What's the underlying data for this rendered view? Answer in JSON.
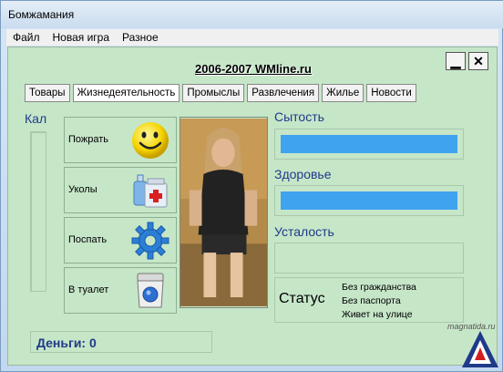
{
  "window": {
    "title": "Бомжамания"
  },
  "menu": {
    "items": [
      "Файл",
      "Новая игра",
      "Разное"
    ]
  },
  "banner": "2006-2007 WMline.ru",
  "window_buttons": {
    "minimize": "▁",
    "close": "✕"
  },
  "tabs": [
    "Товары",
    "Жизнедеятельность",
    "Промыслы",
    "Развлечения",
    "Жилье",
    "Новости"
  ],
  "active_tab": 1,
  "kal": {
    "label": "Кал",
    "level": 0
  },
  "actions": [
    {
      "label": "Пожрать",
      "icon": "smiley-icon"
    },
    {
      "label": "Уколы",
      "icon": "medicine-icon"
    },
    {
      "label": "Поспать",
      "icon": "gear-icon"
    },
    {
      "label": "В туалет",
      "icon": "toilet-icon"
    }
  ],
  "stats": {
    "satiety": {
      "label": "Сытость",
      "value": 1.0
    },
    "health": {
      "label": "Здоровье",
      "value": 1.0
    },
    "fatigue": {
      "label": "Усталость",
      "value": 0.0
    }
  },
  "status": {
    "label": "Статус",
    "lines": [
      "Без гражданства",
      "Без паспорта",
      "Живет на улице"
    ]
  },
  "money": {
    "text": "Деньги: 0"
  },
  "watermark": "magnatida.ru",
  "colors": {
    "client_bg": "#c6e6c8",
    "bar_fill": "#3fa3f0",
    "label_blue": "#1f3a8a"
  }
}
